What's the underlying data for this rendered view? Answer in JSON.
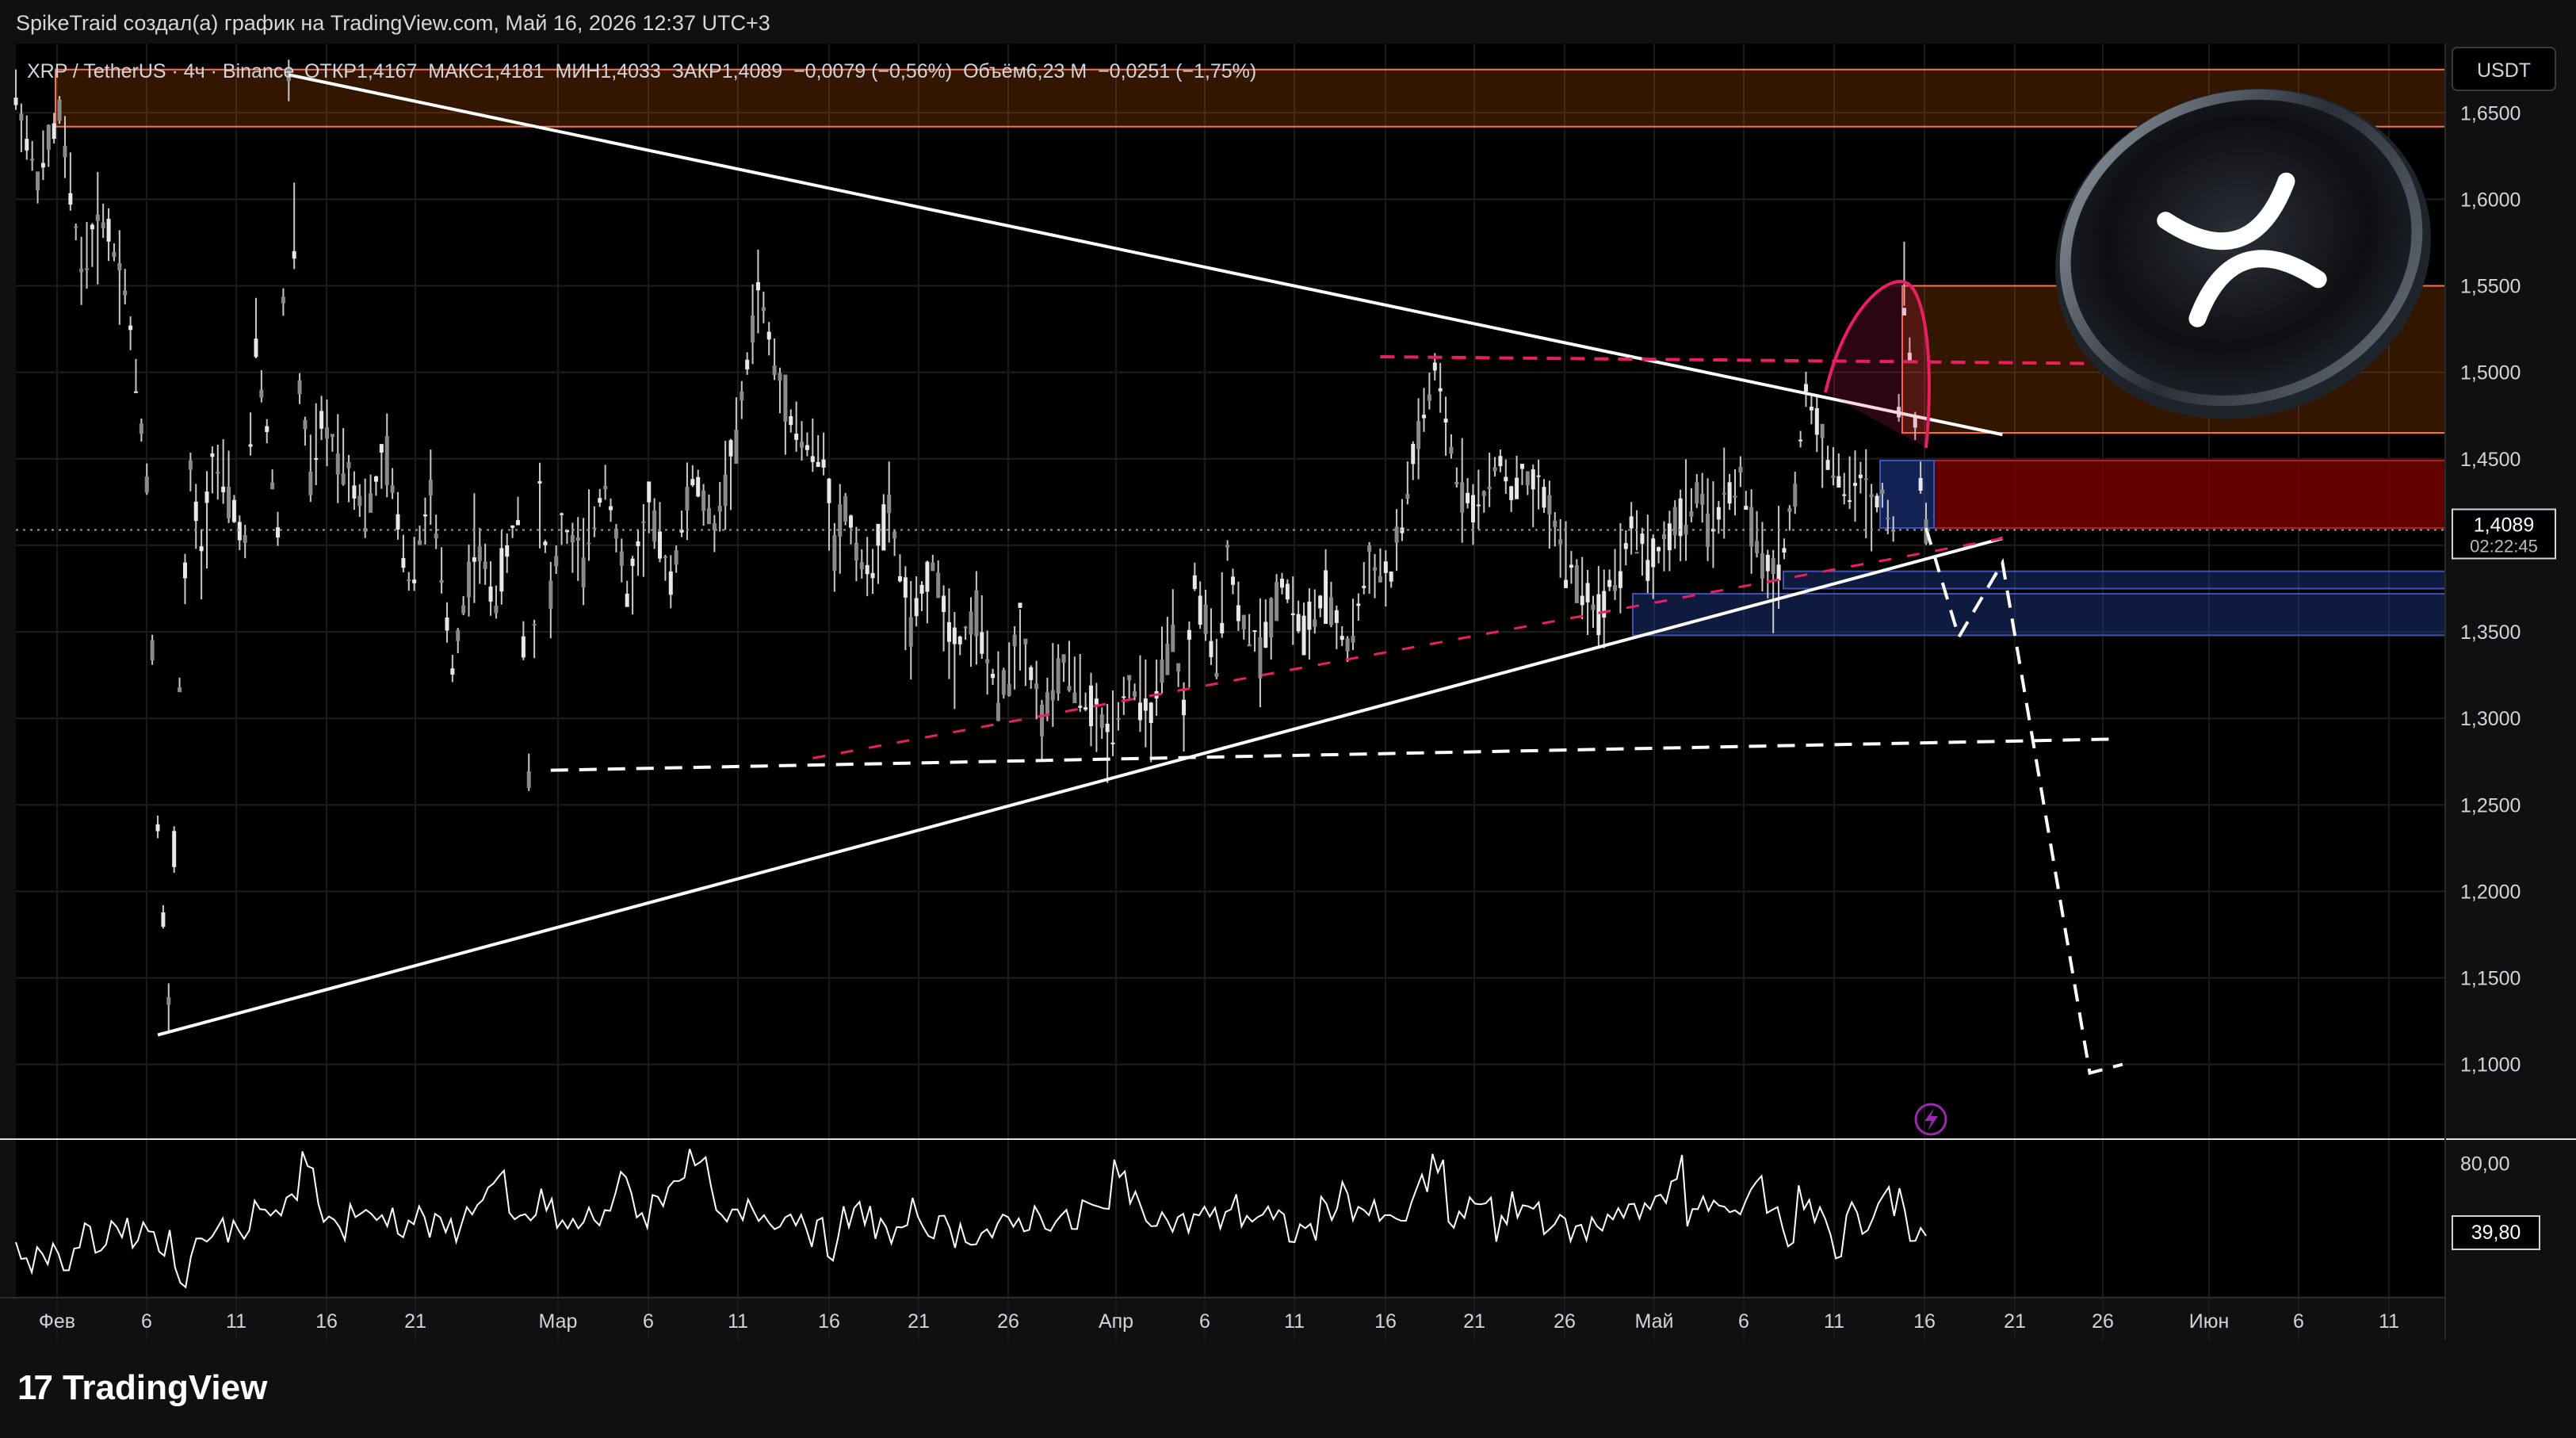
{
  "header": {
    "attribution": "SpikeTraid создал(а) график на TradingView.com, Май 16, 2026 12:37 UTC+3"
  },
  "legend": {
    "symbol": "XRP / TetherUS · 4ч · Binance",
    "ohlc": "ОТКР1,4167  МАКС1,4181  МИН1,4033  ЗАКР1,4089  −0,0079 (−0,56%)  Объём6,23 M  −0,0251 (−1,75%)"
  },
  "currency_button": "USDT",
  "price_badge": {
    "price": "1,4089",
    "countdown": "02:22:45"
  },
  "oscillator_badge": "39,80",
  "footer": {
    "brand": "TradingView",
    "mark": "17"
  },
  "colors": {
    "background": "#000000",
    "candles": "#c9c9c9",
    "trendline": "#ffffff",
    "supply_zone": "#ff6d00",
    "red_zone": "#8b0000",
    "demand_zone": "#1e3a8a",
    "dashed_pink": "#e91e63",
    "oscillator": "#ffffff"
  },
  "chart_data": [
    {
      "type": "candlestick",
      "title": "XRP / TetherUS · 4ч · Binance",
      "y_axis_ticks": [
        "1,6500",
        "1,6000",
        "1,5500",
        "1,5000",
        "1,4500",
        "1,4000",
        "1,3500",
        "1,3000",
        "1,2500",
        "1,2000",
        "1,1500",
        "1,1000"
      ],
      "x_axis_ticks": [
        "Фев",
        "6",
        "11",
        "16",
        "21",
        "Мар",
        "6",
        "11",
        "16",
        "21",
        "26",
        "Апр",
        "6",
        "11",
        "16",
        "21",
        "26",
        "Май",
        "6",
        "11",
        "16",
        "21",
        "26",
        "Июн",
        "6",
        "11"
      ],
      "ylim": [
        1.06,
        1.69
      ],
      "grid": true,
      "last_price": 1.4089,
      "path_x": [
        0,
        2,
        4,
        6,
        8,
        10,
        12,
        13,
        14,
        15,
        16,
        17,
        18,
        20,
        21,
        22,
        24,
        25,
        26,
        27,
        28,
        30,
        32,
        34,
        36,
        38,
        40,
        42,
        44,
        46,
        47,
        48,
        49,
        50,
        52,
        54,
        56,
        58,
        60,
        62,
        64,
        66,
        68,
        70,
        72,
        74,
        75,
        76,
        78,
        80,
        82,
        84,
        86,
        88,
        90,
        92,
        94,
        96,
        98,
        100,
        102,
        104,
        106,
        107,
        108,
        110,
        111,
        112,
        114,
        116,
        118,
        120,
        122,
        124,
        126,
        128,
        130,
        132,
        134,
        136,
        137,
        138,
        139,
        140,
        141,
        142,
        143,
        144,
        145,
        146,
        147,
        148,
        149,
        150,
        151,
        152,
        153,
        154,
        155,
        156,
        157,
        158,
        159,
        160,
        161,
        162,
        163,
        164,
        165,
        166,
        167,
        168,
        169,
        170,
        171,
        172,
        173,
        174,
        175
      ],
      "path_y": [
        1.66,
        1.61,
        1.65,
        1.56,
        1.59,
        1.55,
        1.44,
        1.24,
        1.13,
        1.32,
        1.44,
        1.39,
        1.45,
        1.42,
        1.4,
        1.52,
        1.41,
        1.67,
        1.49,
        1.44,
        1.47,
        1.45,
        1.42,
        1.45,
        1.38,
        1.43,
        1.33,
        1.4,
        1.37,
        1.42,
        1.27,
        1.43,
        1.37,
        1.41,
        1.39,
        1.44,
        1.37,
        1.42,
        1.38,
        1.44,
        1.41,
        1.46,
        1.55,
        1.49,
        1.46,
        1.45,
        1.4,
        1.42,
        1.38,
        1.42,
        1.35,
        1.39,
        1.34,
        1.36,
        1.31,
        1.35,
        1.3,
        1.33,
        1.31,
        1.29,
        1.32,
        1.3,
        1.35,
        1.3,
        1.38,
        1.33,
        1.4,
        1.36,
        1.34,
        1.38,
        1.35,
        1.37,
        1.34,
        1.39,
        1.38,
        1.45,
        1.5,
        1.44,
        1.42,
        1.45,
        1.43,
        1.44,
        1.43,
        1.43,
        1.41,
        1.39,
        1.38,
        1.37,
        1.36,
        1.38,
        1.39,
        1.41,
        1.4,
        1.39,
        1.4,
        1.41,
        1.42,
        1.43,
        1.41,
        1.42,
        1.43,
        1.44,
        1.41,
        1.39,
        1.38,
        1.4,
        1.43,
        1.49,
        1.47,
        1.45,
        1.44,
        1.43,
        1.44,
        1.42,
        1.43,
        1.41,
        1.55,
        1.47,
        1.41
      ],
      "zones": [
        {
          "kind": "supply",
          "y_top": 1.675,
          "y_bottom": 1.642
        },
        {
          "kind": "supply",
          "y_top": 1.55,
          "y_bottom": 1.465
        },
        {
          "kind": "red",
          "y_top": 1.449,
          "y_bottom": 1.41
        },
        {
          "kind": "demand",
          "y_top": 1.385,
          "y_bottom": 1.375
        },
        {
          "kind": "demand",
          "y_top": 1.372,
          "y_bottom": 1.348
        }
      ],
      "trendlines": [
        {
          "kind": "descending",
          "from": [
            25,
            1.672
          ],
          "to": [
            182,
            1.464
          ]
        },
        {
          "kind": "ascending",
          "from": [
            13,
            1.117
          ],
          "to": [
            182,
            1.404
          ]
        },
        {
          "kind": "support_dashed",
          "from": [
            49,
            1.27
          ],
          "to": [
            192,
            1.288
          ]
        },
        {
          "kind": "resistance_dashed_pink",
          "from": [
            125,
            1.509
          ],
          "to": [
            192,
            1.505
          ]
        },
        {
          "kind": "projection_dashed",
          "points": [
            [
              175,
              1.41
            ],
            [
              178,
              1.347
            ],
            [
              182,
              1.39
            ],
            [
              190,
              1.095
            ],
            [
              193,
              1.1
            ]
          ]
        }
      ]
    },
    {
      "type": "line",
      "title": "",
      "y_axis_ticks": [
        "80,00"
      ],
      "ylim": [
        20,
        90
      ],
      "last_value": 39.8,
      "values": [
        38,
        36,
        40,
        34,
        46,
        44,
        52,
        48,
        50,
        44,
        28,
        44,
        48,
        50,
        52,
        56,
        58,
        60,
        82,
        60,
        50,
        58,
        54,
        56,
        52,
        55,
        50,
        50,
        56,
        66,
        70,
        52,
        56,
        62,
        50,
        52,
        55,
        60,
        72,
        56,
        62,
        74,
        80,
        76,
        52,
        54,
        58,
        56,
        56,
        56,
        48,
        42,
        54,
        58,
        50,
        44,
        58,
        52,
        50,
        48,
        48,
        48,
        50,
        54,
        56,
        54,
        52,
        60,
        56,
        80,
        60,
        58,
        54,
        52,
        56,
        54,
        60,
        56,
        56,
        52,
        48,
        50,
        58,
        66,
        60,
        56,
        52,
        56,
        68,
        80,
        52,
        58,
        64,
        50,
        60,
        60,
        54,
        50,
        48,
        52,
        58,
        60,
        56,
        64,
        78,
        54,
        62,
        58,
        56,
        74,
        60,
        46,
        64,
        58,
        42,
        56,
        48,
        66,
        62,
        44,
        40
      ]
    }
  ]
}
